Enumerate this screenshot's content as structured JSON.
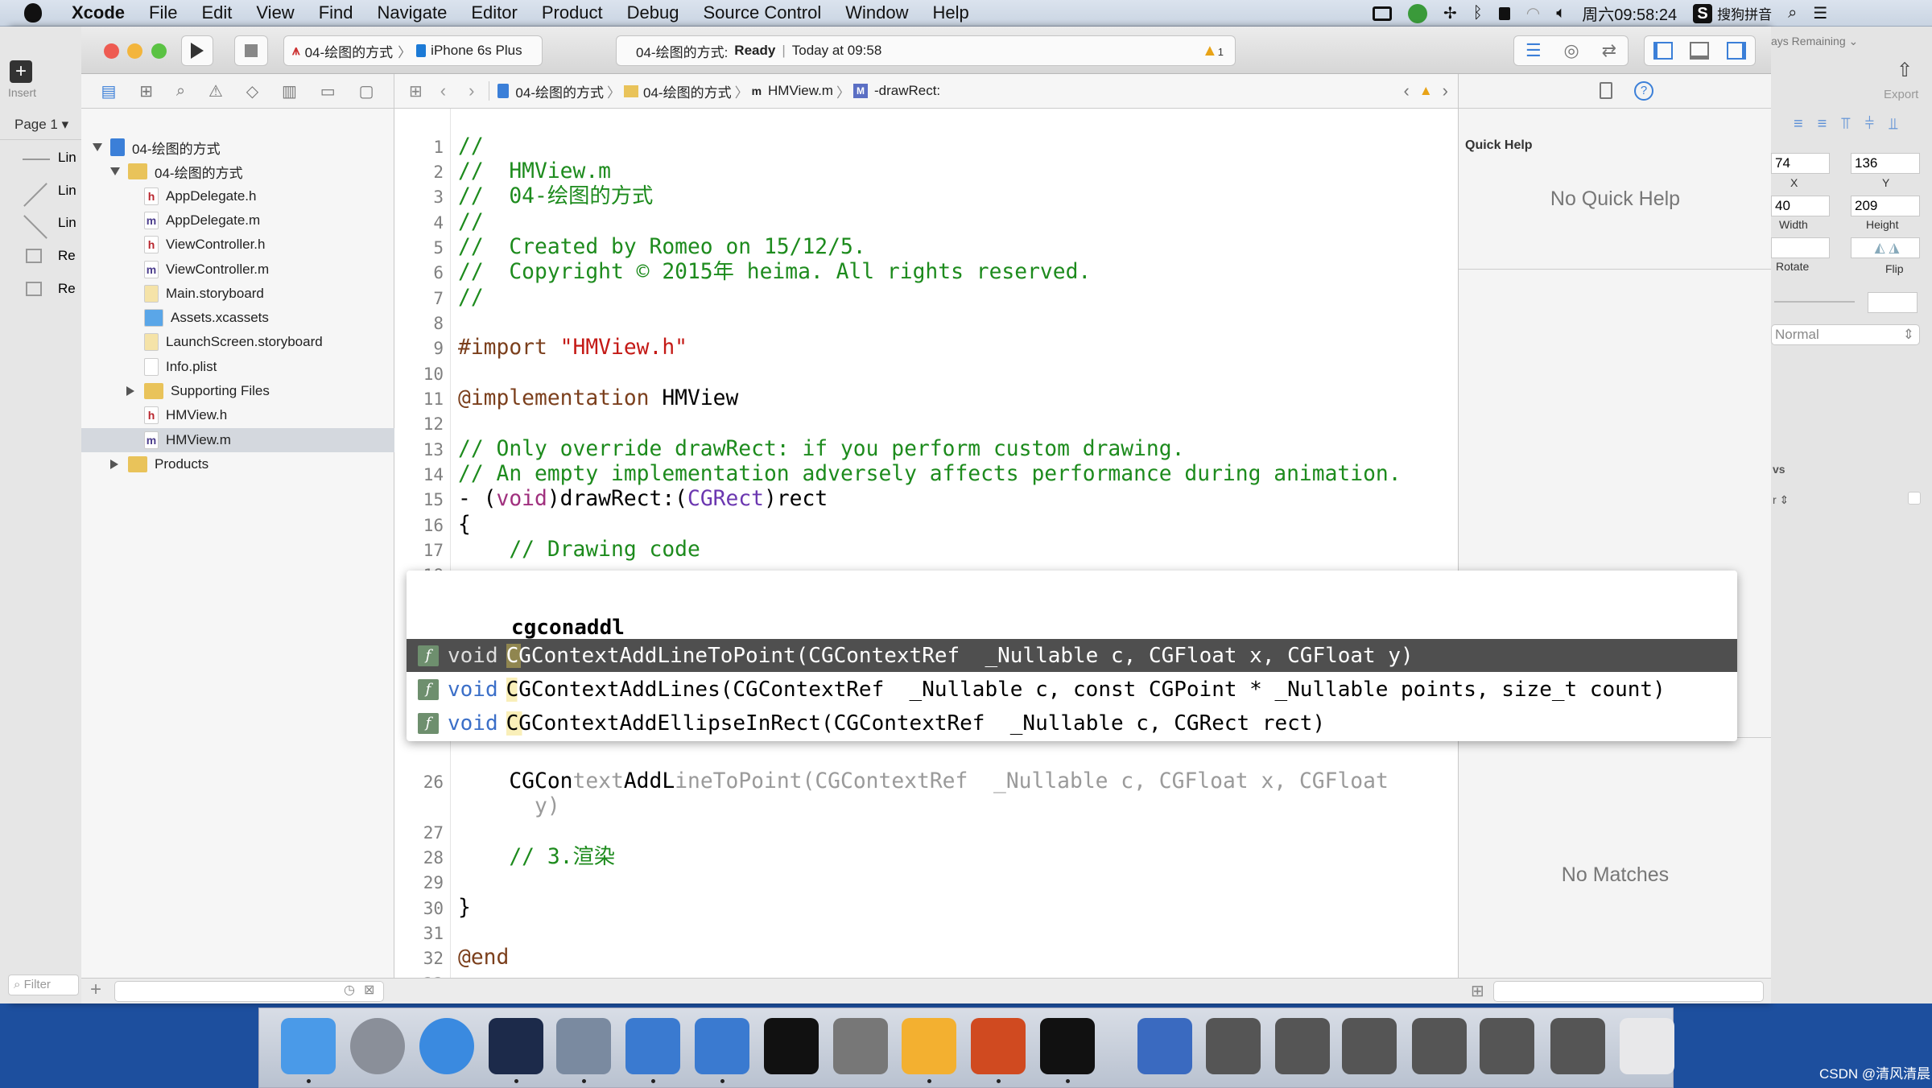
{
  "menubar": {
    "items": [
      "Xcode",
      "File",
      "Edit",
      "View",
      "Find",
      "Navigate",
      "Editor",
      "Product",
      "Debug",
      "Source Control",
      "Window",
      "Help"
    ],
    "clock": "周六09:58:24",
    "input_method": "搜狗拼音"
  },
  "toolbar": {
    "scheme": "04-绘图的方式",
    "device": "iPhone 6s Plus",
    "status_project": "04-绘图的方式:",
    "status_state": "Ready",
    "status_time": "Today at 09:58",
    "warning_count": "1"
  },
  "library": {
    "insert_label": "Insert",
    "page": "Page 1",
    "items": [
      "Lin",
      "Lin",
      "Lin",
      "Re",
      "Re"
    ],
    "filter_placeholder": "Filter"
  },
  "jumpbar": {
    "crumbs": [
      "04-绘图的方式",
      "04-绘图的方式",
      "HMView.m",
      "-drawRect:"
    ]
  },
  "navigator": {
    "rows": [
      {
        "label": "04-绘图的方式",
        "type": "project",
        "level": 0,
        "expanded": true
      },
      {
        "label": "04-绘图的方式",
        "type": "folder",
        "level": 1,
        "expanded": true
      },
      {
        "label": "AppDelegate.h",
        "type": "h",
        "level": 2
      },
      {
        "label": "AppDelegate.m",
        "type": "m",
        "level": 2
      },
      {
        "label": "ViewController.h",
        "type": "h",
        "level": 2
      },
      {
        "label": "ViewController.m",
        "type": "m",
        "level": 2
      },
      {
        "label": "Main.storyboard",
        "type": "storyboard",
        "level": 2
      },
      {
        "label": "Assets.xcassets",
        "type": "assets",
        "level": 2
      },
      {
        "label": "LaunchScreen.storyboard",
        "type": "storyboard",
        "level": 2
      },
      {
        "label": "Info.plist",
        "type": "plist",
        "level": 2
      },
      {
        "label": "Supporting Files",
        "type": "folder",
        "level": 2,
        "expanded": false
      },
      {
        "label": "HMView.h",
        "type": "h",
        "level": 2
      },
      {
        "label": "HMView.m",
        "type": "m",
        "level": 2,
        "selected": true
      },
      {
        "label": "Products",
        "type": "folder",
        "level": 1,
        "expanded": false
      }
    ]
  },
  "editor": {
    "lines": [
      {
        "n": "1",
        "segs": [
          [
            "//",
            "com"
          ]
        ]
      },
      {
        "n": "2",
        "segs": [
          [
            "//  HMView.m",
            "com"
          ]
        ]
      },
      {
        "n": "3",
        "segs": [
          [
            "//  04-绘图的方式",
            "com"
          ]
        ]
      },
      {
        "n": "4",
        "segs": [
          [
            "//",
            "com"
          ]
        ]
      },
      {
        "n": "5",
        "segs": [
          [
            "//  Created by Romeo on 15/12/5.",
            "com"
          ]
        ]
      },
      {
        "n": "6",
        "segs": [
          [
            "//  Copyright © 2015年 heima. All rights reserved.",
            "com"
          ]
        ]
      },
      {
        "n": "7",
        "segs": [
          [
            "//",
            "com"
          ]
        ]
      },
      {
        "n": "8",
        "segs": []
      },
      {
        "n": "9",
        "segs": [
          [
            "#import ",
            "pre"
          ],
          [
            "\"HMView.h\"",
            "str"
          ]
        ]
      },
      {
        "n": "10",
        "segs": []
      },
      {
        "n": "11",
        "segs": [
          [
            "@implementation ",
            "pre"
          ],
          [
            "HMView",
            ""
          ]
        ]
      },
      {
        "n": "12",
        "segs": []
      },
      {
        "n": "13",
        "segs": [
          [
            "// Only override drawRect: if you perform custom drawing.",
            "com"
          ]
        ]
      },
      {
        "n": "14",
        "segs": [
          [
            "// An empty implementation adversely affects performance during animation.",
            "com"
          ]
        ]
      },
      {
        "n": "15",
        "segs": [
          [
            "- (",
            ""
          ],
          [
            "void",
            "kw"
          ],
          [
            ")drawRect:(",
            ""
          ],
          [
            "CGRect",
            "typ"
          ],
          [
            ")rect",
            ""
          ]
        ]
      },
      {
        "n": "16",
        "segs": [
          [
            "{",
            ""
          ]
        ]
      },
      {
        "n": "17",
        "segs": [
          [
            "    // Drawing code",
            "com"
          ]
        ]
      },
      {
        "n": "18",
        "segs": []
      },
      {
        "n": "26",
        "segs": [
          [
            "    CGCon",
            ""
          ],
          [
            "text",
            "ph"
          ],
          [
            "AddL",
            ""
          ],
          [
            "ineToPoint(CGContextRef  _Nullable c, CGFloat x, CGFloat",
            "ph"
          ]
        ]
      },
      {
        "n": "",
        "segs": [
          [
            "      y)",
            "ph"
          ]
        ]
      },
      {
        "n": "27",
        "segs": []
      },
      {
        "n": "28",
        "segs": [
          [
            "    // 3.渲染",
            "com"
          ]
        ]
      },
      {
        "n": "29",
        "segs": []
      },
      {
        "n": "30",
        "segs": [
          [
            "}",
            ""
          ]
        ]
      },
      {
        "n": "31",
        "segs": []
      },
      {
        "n": "32",
        "segs": [
          [
            "@end",
            "pre"
          ]
        ]
      },
      {
        "n": "33",
        "segs": []
      }
    ]
  },
  "autocomplete": {
    "typed": "cgconaddl",
    "items": [
      {
        "ret": "void",
        "name": "CGContextAddLineToPoint",
        "args": "(CGContextRef  _Nullable c, CGFloat x, CGFloat y)",
        "selected": true
      },
      {
        "ret": "void",
        "name": "CGContextAddLines",
        "args": "(CGContextRef  _Nullable c, const CGPoint * _Nullable points, size_t count)"
      },
      {
        "ret": "void",
        "name": "CGContextAddEllipseInRect",
        "args": "(CGContextRef  _Nullable c, CGRect rect)"
      }
    ]
  },
  "quickhelp": {
    "title": "Quick Help",
    "empty": "No Quick Help",
    "library_empty": "No Matches"
  },
  "inspector": {
    "trial": "ays Remaining",
    "export": "Export",
    "x": "74",
    "y": "136",
    "x_label": "X",
    "y_label": "Y",
    "width": "40",
    "height": "209",
    "width_label": "Width",
    "height_label": "Height",
    "rotate_label": "Rotate",
    "flip_label": "Flip",
    "blend": "Normal",
    "section": "vs",
    "option": "r"
  },
  "dock": {
    "apps": [
      "finder",
      "launchpad",
      "safari",
      "mouse",
      "video-editor",
      "xcode",
      "simulator",
      "terminal",
      "system-preferences",
      "sketch",
      "powerpoint",
      "console",
      "quicktime",
      "display-1",
      "display-2",
      "display-3",
      "display-4",
      "display-5",
      "display-6",
      "trash"
    ]
  },
  "watermark": "CSDN @清风清晨",
  "colors": {
    "comment": "#1d8b1d",
    "preprocessor": "#7b3f1c",
    "string": "#c41a16",
    "keyword": "#a0307e",
    "selection": "#4f4f4f",
    "desktop": "#1d4f9e"
  }
}
